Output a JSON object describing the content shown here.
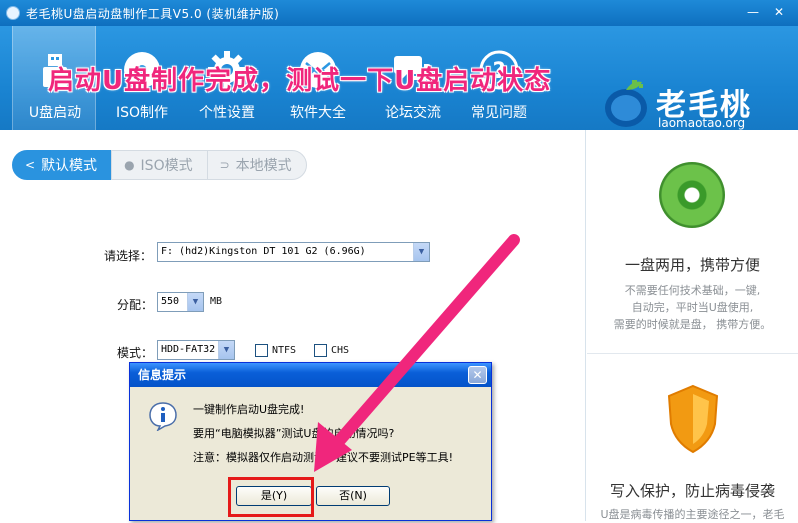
{
  "window": {
    "title": "老毛桃U盘启动盘制作工具V5.0 (装机维护版)",
    "minimize_glyph": "—",
    "close_glyph": "✕"
  },
  "toolbar": {
    "items": [
      {
        "label": "U盘启动",
        "icon": "usb-drive-icon",
        "active": true
      },
      {
        "label": "ISO制作",
        "icon": "disc-icon"
      },
      {
        "label": "个性设置",
        "icon": "gear-icon"
      },
      {
        "label": "软件大全",
        "icon": "envelope-globe-icon"
      },
      {
        "label": "论坛交流",
        "icon": "chat-bubbles-icon"
      },
      {
        "label": "常见问题",
        "icon": "question-icon"
      }
    ]
  },
  "logo": {
    "brand": "老毛桃",
    "domain": "laomaotao.org"
  },
  "mode_tabs": [
    {
      "label": "默认模式",
      "icon": "share-icon",
      "active": true
    },
    {
      "label": "ISO模式",
      "icon": "disc-small-icon"
    },
    {
      "label": "本地模式",
      "icon": "signal-icon"
    }
  ],
  "banner": "启动U盘制作完成，测试一下U盘启动状态",
  "form": {
    "select_label": "请选择：",
    "select_value": "F: (hd2)Kingston DT 101 G2 (6.96G)",
    "partition_label": "分配：",
    "partition_value": "550",
    "partition_unit": "MB",
    "mode_label": "模式：",
    "mode_value": "HDD-FAT32",
    "ntfs_label": "NTFS",
    "chs_label": "CHS"
  },
  "right_panel": {
    "feature1_title": "一盘两用，携带方便",
    "feature1_desc": [
      "不需要任何技术基础，一键,",
      "自动完，平时当U盘使用,",
      "需要的时候就是盘， 携带方便。"
    ],
    "feature2_title": "写入保护，防止病毒侵袭",
    "feature2_desc": "U盘是病毒传播的主要途径之一，老毛"
  },
  "dialog": {
    "title": "信息提示",
    "line1": "一键制作启动U盘完成!",
    "line2": "要用“电脑模拟器”测试U盘的启动情况吗?",
    "line3": "注意：模拟器仅作启动测试，建议不要测试PE等工具!",
    "yes_label": "是(Y)",
    "no_label": "否(N)"
  },
  "colors": {
    "accent": "#1a84d2",
    "banner": "#f0267c",
    "highlight": "#e51919"
  }
}
